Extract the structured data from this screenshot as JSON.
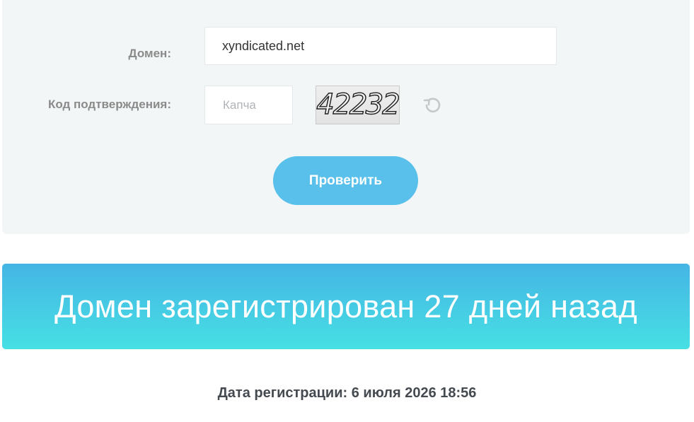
{
  "form": {
    "domain_label": "Домен:",
    "domain_value": "xyndicated.net",
    "code_label": "Код подтверждения:",
    "captcha_placeholder": "Капча",
    "captcha_code": "42232",
    "submit_label": "Проверить"
  },
  "icons": {
    "refresh": "refresh-icon"
  },
  "result": {
    "headline": "Домен зарегистрирован 27 дней назад",
    "registration_date": "Дата регистрации: 6 июля 2026 18:56"
  },
  "colors": {
    "form_background": "#f3f6f7",
    "button": "#58c0ea",
    "banner_top": "#45b5e4",
    "banner_bottom": "#46e0e4",
    "label_text": "#8a8a8a",
    "date_text": "#444a50"
  }
}
